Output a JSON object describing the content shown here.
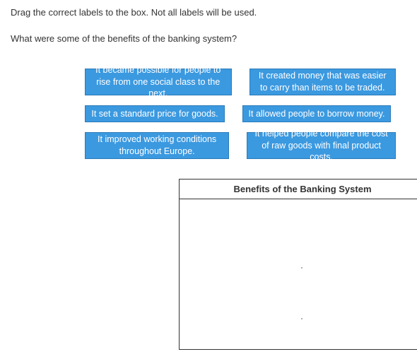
{
  "instruction": "Drag the correct labels to the box. Not all labels will be used.",
  "question": "What were some of the benefits of the banking system?",
  "labels": {
    "l1": "It became possible for people to rise from one social class to the next.",
    "l2": "It created money that was easier to carry than items to be traded.",
    "l3": "It set a standard price for goods.",
    "l4": "It allowed people to borrow money.",
    "l5": "It improved working conditions throughout Europe.",
    "l6": "It helped people compare the cost of raw goods with final product costs."
  },
  "dropbox": {
    "title": "Benefits of the Banking System"
  }
}
